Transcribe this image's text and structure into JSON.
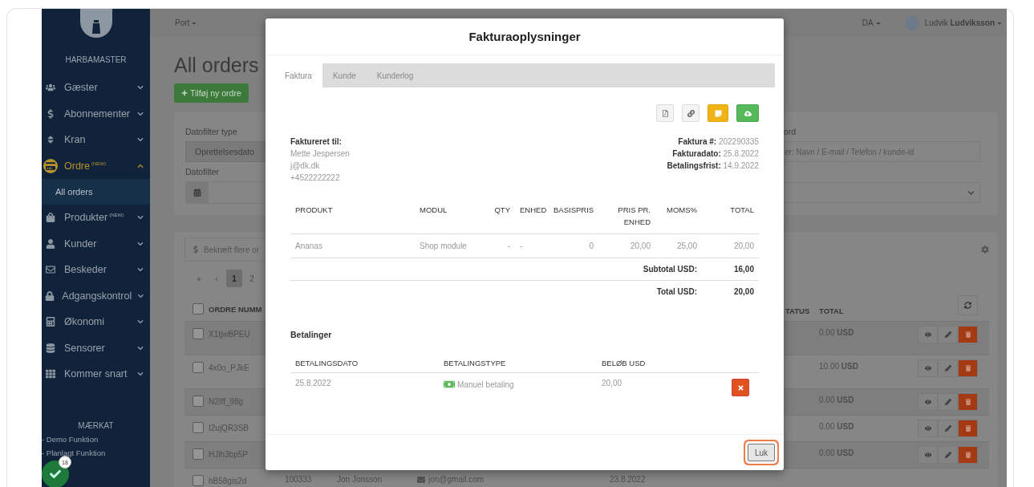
{
  "top_bar": {
    "port_menu": "Port",
    "language": "DA",
    "user": "Ludvik **Ludviksson**"
  },
  "sidebar": {
    "brand": "HARBAMASTER",
    "items": [
      {
        "label": "Gæster",
        "expanded": false,
        "selected": false
      },
      {
        "label": "Abonnementer",
        "expanded": false,
        "selected": false
      },
      {
        "label": "Kran",
        "expanded": false,
        "selected": false
      },
      {
        "label": "Ordre",
        "badge": "(NEW)",
        "expanded": true,
        "selected": true,
        "children": [
          {
            "label": "All orders",
            "selected": true
          }
        ]
      },
      {
        "label": "Produkter",
        "badge": "(NEW)",
        "expanded": false,
        "selected": false
      },
      {
        "label": "Kunder",
        "expanded": false,
        "selected": false
      },
      {
        "label": "Beskeder",
        "expanded": false,
        "selected": false
      },
      {
        "label": "Adgangskontrol",
        "expanded": false,
        "selected": false
      },
      {
        "label": "Økonomi",
        "expanded": false,
        "selected": false
      },
      {
        "label": "Sensorer",
        "expanded": false,
        "selected": false
      },
      {
        "label": "Kommer snart",
        "expanded": false,
        "selected": false
      }
    ],
    "legend": {
      "title": "MÆRKAT",
      "items": [
        "- Demo Funktion",
        "- Planlagt Funktion"
      ]
    }
  },
  "notification": {
    "count": "18"
  },
  "page": {
    "title": "All orders",
    "add_button": "Tilføj ny ordre",
    "filters": {
      "date_type_label": "Datofilter type",
      "date_type_value": "Oprettelsesdato",
      "date_label": "Datofilter",
      "search_label": "ord",
      "search_placeholder": "er: Navn / E-mail / Telefon / kunde-id"
    },
    "confirm_button": "Bekræft flere or",
    "pagination": [
      {
        "label": "«",
        "selected": false
      },
      {
        "label": "‹",
        "selected": false
      },
      {
        "label": "1",
        "selected": true
      },
      {
        "label": "2",
        "selected": false
      }
    ],
    "table": {
      "all_checked": false,
      "columns": {
        "order_no": "ORDRE NUMM",
        "status": "TATUS",
        "total": "TOTAL"
      },
      "rows": [
        {
          "order_no": "X1tjwBPEU",
          "total": "0.00 **USD**",
          "checked": false
        },
        {
          "order_no": "4x0o_PJkE",
          "total": "10.00 **USD**",
          "checked": false
        },
        {
          "order_no": "N2Iff_98g",
          "total": "0.00 **USD**",
          "checked": false
        },
        {
          "order_no": "I2ujQR3SB",
          "total": "0.00 **USD**",
          "checked": false
        },
        {
          "order_no": "HJlh3bp5P",
          "total": "0.00 **USD**",
          "checked": false
        },
        {
          "order_no": "hB58gis2d",
          "number": "100333",
          "customer": "Jon Jonsson",
          "email": "jon@gmail.com",
          "date": "23.8.2022",
          "checked": false
        }
      ]
    }
  },
  "invoice_modal": {
    "title": "Fakturaoplysninger",
    "tabs": [
      {
        "label": "Faktura",
        "selected": true
      },
      {
        "label": "Kunde",
        "selected": false
      },
      {
        "label": "Kunderlog",
        "selected": false
      }
    ],
    "billed_to": {
      "label": "Faktureret til:",
      "lines": [
        "Mette Jespersen",
        "j@dk.dk",
        "+4522222222"
      ]
    },
    "meta": [
      {
        "label": "Faktura #:",
        "value": "202290335"
      },
      {
        "label": "Fakturadato:",
        "value": "25.8.2022"
      },
      {
        "label": "Betalingsfrist:",
        "value": "14.9.2022"
      }
    ],
    "items": {
      "columns": [
        "PRODUKT",
        "MODUL",
        "QTY",
        "ENHED",
        "BASISPRIS",
        "PRIS PR. ENHED",
        "MOMS%",
        "TOTAL"
      ],
      "rows": [
        [
          "Ananas",
          "Shop module",
          "-",
          "-",
          "0",
          "20,00",
          "25,00",
          "20,00"
        ]
      ],
      "totals": [
        {
          "label": "Subtotal USD:",
          "value": "16,00"
        },
        {
          "label": "Total USD:",
          "value": "20,00"
        }
      ]
    },
    "payments": {
      "title": "Betalinger",
      "columns": [
        "BETALINGSDATO",
        "BETALINGSTYPE",
        "BELØB USD"
      ],
      "rows": [
        {
          "date": "25.8.2022",
          "type": "Manuel betaling",
          "amount": "20,00"
        }
      ]
    },
    "close_button": "Luk"
  }
}
